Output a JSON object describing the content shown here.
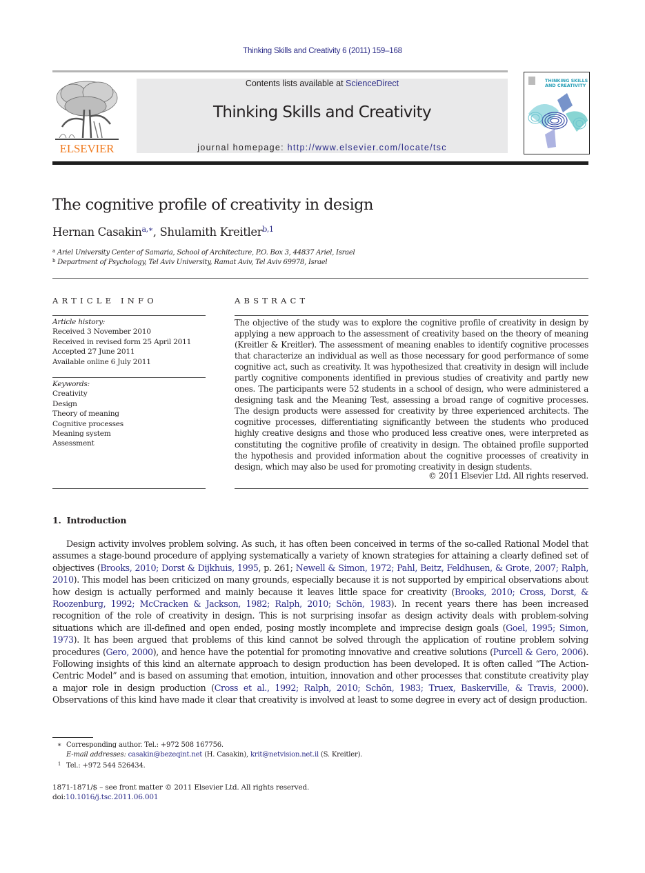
{
  "running_head": "Thinking Skills and Creativity 6 (2011) 159–168",
  "masthead": {
    "contents_prefix": "Contents lists available at ",
    "contents_link": "ScienceDirect",
    "journal_title": "Thinking Skills and Creativity",
    "homepage_prefix": "journal homepage: ",
    "homepage_url": "http://www.elsevier.com/locate/tsc"
  },
  "publisher": {
    "wordmark": "ELSEVIER",
    "logo_icon": "elsevier-tree-icon"
  },
  "cover": {
    "title_line1": "THINKING SKILLS",
    "title_line2": "AND CREATIVITY"
  },
  "colors": {
    "link": "#2a2a86",
    "elsevier_orange": "#f07a1e",
    "masthead_bg": "#e9e9ea"
  },
  "article": {
    "title": "The cognitive profile of creativity in design",
    "authors": [
      {
        "name": "Hernan Casakin",
        "marks": "a,∗"
      },
      {
        "name": "Shulamith Kreitler",
        "marks": "b,1"
      }
    ],
    "author_separator": ", ",
    "affiliations": [
      {
        "mark": "a",
        "text": "Ariel University Center of Samaria, School of Architecture, P.O. Box 3, 44837 Ariel, Israel"
      },
      {
        "mark": "b",
        "text": "Department of Psychology, Tel Aviv University, Ramat Aviv, Tel Aviv 69978, Israel"
      }
    ]
  },
  "article_info": {
    "heading": "ARTICLE INFO",
    "history_label": "Article history:",
    "history": [
      "Received 3 November 2010",
      "Received in revised form 25 April 2011",
      "Accepted 27 June 2011",
      "Available online 6 July 2011"
    ],
    "keywords_label": "Keywords:",
    "keywords": [
      "Creativity",
      "Design",
      "Theory of meaning",
      "Cognitive processes",
      "Meaning system",
      "Assessment"
    ]
  },
  "abstract": {
    "heading": "ABSTRACT",
    "text": "The objective of the study was to explore the cognitive profile of creativity in design by applying a new approach to the assessment of creativity based on the theory of meaning (Kreitler & Kreitler). The assessment of meaning enables to identify cognitive processes that characterize an individual as well as those necessary for good performance of some cognitive act, such as creativity. It was hypothesized that creativity in design will include partly cognitive components identified in previous studies of creativity and partly new ones. The participants were 52 students in a school of design, who were administered a designing task and the Meaning Test, assessing a broad range of cognitive processes. The design products were assessed for creativity by three experienced architects. The cognitive processes, differentiating significantly between the students who produced highly creative designs and those who produced less creative ones, were interpreted as constituting the cognitive profile of creativity in design. The obtained profile supported the hypothesis and provided information about the cognitive processes of creativity in design, which may also be used for promoting creativity in design students.",
    "copyright": "© 2011 Elsevier Ltd. All rights reserved."
  },
  "introduction": {
    "number": "1.",
    "title": "Introduction",
    "segments": [
      {
        "t": "Design activity involves problem solving. As such, it has often been conceived in terms of the so-called Rational Model that assumes a stage-bound procedure of applying systematically a variety of known strategies for attaining a clearly defined set of objectives ("
      },
      {
        "link": "Brooks, 2010; Dorst & Dijkhuis, 1995"
      },
      {
        "t": ", p. 261; "
      },
      {
        "link": "Newell & Simon, 1972; Pahl, Beitz, Feldhusen, & Grote, 2007; Ralph, 2010"
      },
      {
        "t": "). This model has been criticized on many grounds, especially because it is not supported by empirical observations about how design is actually performed and mainly because it leaves little space for creativity ("
      },
      {
        "link": "Brooks, 2010; Cross, Dorst, & Roozenburg, 1992; McCracken & Jackson, 1982; Ralph, 2010; Schön, 1983"
      },
      {
        "t": "). In recent years there has been increased recognition of the role of creativity in design. This is not surprising insofar as design activity deals with problem-solving situations which are ill-defined and open ended, posing mostly incomplete and imprecise design goals ("
      },
      {
        "link": "Goel, 1995; Simon, 1973"
      },
      {
        "t": "). It has been argued that problems of this kind cannot be solved through the application of routine problem solving procedures ("
      },
      {
        "link": "Gero, 2000"
      },
      {
        "t": "), and hence have the potential for promoting innovative and creative solutions ("
      },
      {
        "link": "Purcell & Gero, 2006"
      },
      {
        "t": "). Following insights of this kind an alternate approach to design production has been developed. It is often called “The Action-Centric Model” and is based on assuming that emotion, intuition, innovation and other processes that constitute creativity play a major role in design production ("
      },
      {
        "link": "Cross et al., 1992; Ralph, 2010; Schön, 1983; Truex, Baskerville, & Travis, 2000"
      },
      {
        "t": "). Observations of this kind have made it clear that creativity is involved at least to some degree in every act of design production."
      }
    ]
  },
  "footnotes": {
    "star_mark": "∗",
    "star_text": "Corresponding author. Tel.: +972 508 167756.",
    "email_label": "E-mail addresses:",
    "email1": "casakin@bezeqint.net",
    "email1_owner": " (H. Casakin), ",
    "email2": "krit@netvision.net.il",
    "email2_owner": " (S. Kreitler).",
    "one_mark": "1",
    "one_text": "Tel.: +972 544 526434."
  },
  "front_matter": "1871-1871/$ – see front matter © 2011 Elsevier Ltd. All rights reserved.",
  "doi_prefix": "doi:",
  "doi": "10.1016/j.tsc.2011.06.001"
}
